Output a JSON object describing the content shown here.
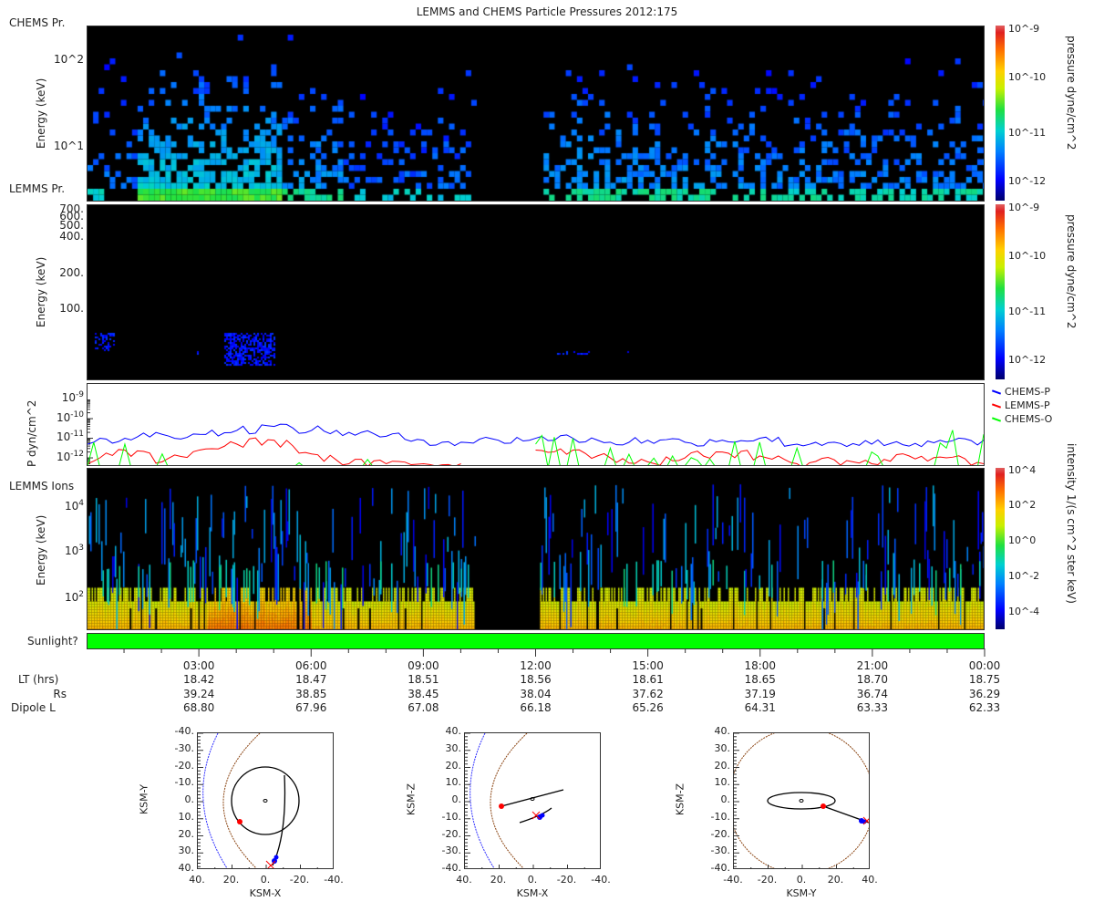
{
  "title": "LEMMS and CHEMS Particle Pressures  2012:175",
  "panel_labels": {
    "chems": "CHEMS Pr.",
    "lemms": "LEMMS Pr.",
    "ions": "LEMMS Ions",
    "sunlight": "Sunlight?"
  },
  "colorbars": {
    "pressure": {
      "label": "pressure dyne/cm^2",
      "ticks": [
        "10^-9",
        "10^-10",
        "10^-11",
        "10^-12"
      ]
    },
    "intensity": {
      "label": "intensity 1/(s cm^2 ster keV)",
      "ticks": [
        "10^4",
        "10^2",
        "10^0",
        "10^-2",
        "10^-4"
      ]
    }
  },
  "x_axis": {
    "times": [
      "03:00",
      "06:00",
      "09:00",
      "12:00",
      "15:00",
      "18:00",
      "21:00",
      "00:00"
    ],
    "rows": [
      {
        "label": "LT (hrs)",
        "values": [
          "18.42",
          "18.47",
          "18.51",
          "18.56",
          "18.61",
          "18.65",
          "18.70",
          "18.75"
        ]
      },
      {
        "label": "Rs",
        "values": [
          "39.24",
          "38.85",
          "38.45",
          "38.04",
          "37.62",
          "37.19",
          "36.74",
          "36.29"
        ]
      },
      {
        "label": "Dipole L",
        "values": [
          "68.80",
          "67.96",
          "67.08",
          "66.18",
          "65.26",
          "64.31",
          "63.33",
          "62.33"
        ]
      }
    ]
  },
  "chart_data": [
    {
      "type": "heatmap",
      "name": "CHEMS Pr.",
      "ylabel": "Energy (keV)",
      "yscale": "log",
      "ylim": [
        2.4,
        250
      ],
      "yticks": [
        "10^2",
        "10^1"
      ],
      "xlim_hours": [
        0,
        24
      ],
      "data_gap_hours": [
        10.4,
        12.1
      ],
      "colorbar": "pressure"
    },
    {
      "type": "heatmap",
      "name": "LEMMS Pr.",
      "ylabel": "Energy (keV)",
      "yscale": "log",
      "ylim": [
        25,
        780
      ],
      "yticks": [
        "700.",
        "600.",
        "500.",
        "400.",
        "200.",
        "100."
      ],
      "xlim_hours": [
        0,
        24
      ],
      "colorbar": "pressure"
    },
    {
      "type": "line",
      "ylabel": "P dyn/cm^2",
      "yscale": "log",
      "ylim": [
        4.3e-13,
        6e-09
      ],
      "yticks": [
        "10^-9",
        "10^-10",
        "10^-11",
        "10^-12"
      ],
      "x_hours": [
        0,
        1,
        2,
        3,
        4,
        5,
        6,
        7,
        8,
        9,
        10,
        11,
        12,
        13,
        14,
        15,
        16,
        17,
        18,
        19,
        20,
        21,
        22,
        23,
        24
      ],
      "series": [
        {
          "name": "CHEMS-P",
          "color": "#0000ff",
          "log10_values": [
            -11.3,
            -11.0,
            -10.8,
            -10.8,
            -10.6,
            -10.4,
            -10.6,
            -10.7,
            -10.9,
            -11.1,
            -11.2,
            -11.1,
            -11.0,
            -11.0,
            -11.2,
            -11.1,
            -11.2,
            -11.1,
            -11.0,
            -11.3,
            -11.2,
            -11.3,
            -11.4,
            -11.2,
            -11.1
          ]
        },
        {
          "name": "LEMMS-P",
          "color": "#ff0000",
          "log10_values": [
            -12.3,
            -11.6,
            -12.2,
            -11.6,
            -11.3,
            -11.1,
            -11.8,
            -12.3,
            -12.3,
            -12.3,
            -12.3,
            null,
            -11.6,
            -11.6,
            -12.0,
            -12.2,
            -12.0,
            -11.7,
            -11.9,
            -12.3,
            -12.1,
            -12.3,
            -11.9,
            -12.0,
            -12.3
          ]
        },
        {
          "name": "CHEMS-O",
          "color": "#00ff00",
          "log10_values": [
            -12.4,
            -11.3,
            -11.8,
            -12.4,
            -12.4,
            -12.4,
            -12.4,
            -12.4,
            -12.4,
            -12.4,
            null,
            null,
            -11.3,
            -11.0,
            -11.5,
            -12.4,
            -12.4,
            -12.4,
            -11.2,
            -11.5,
            -12.4,
            -11.7,
            -12.4,
            -11.5,
            -10.8
          ]
        }
      ],
      "legend": "right"
    },
    {
      "type": "heatmap",
      "name": "LEMMS Ions",
      "ylabel": "Energy (keV)",
      "yscale": "log",
      "ylim": [
        21,
        72000
      ],
      "yticks": [
        "10^4",
        "10^3",
        "10^2"
      ],
      "xlim_hours": [
        0,
        24
      ],
      "data_gap_hours": [
        10.4,
        12.1
      ],
      "colorbar": "intensity"
    }
  ],
  "orbits": [
    {
      "xlabel": "KSM-X",
      "ylabel": "KSM-Y",
      "xticks": [
        "40.",
        "20.",
        "0.",
        "-20.",
        "-40."
      ],
      "yticks": [
        "-40.",
        "-30.",
        "-20.",
        "-10.",
        "0.",
        "10.",
        "20.",
        "30.",
        "40."
      ]
    },
    {
      "xlabel": "KSM-X",
      "ylabel": "KSM-Z",
      "xticks": [
        "40.",
        "20.",
        "0.",
        "-20.",
        "-40."
      ],
      "yticks": [
        "40.",
        "30.",
        "20.",
        "10.",
        "0.",
        "-10.",
        "-20.",
        "-30.",
        "-40."
      ]
    },
    {
      "xlabel": "KSM-Y",
      "ylabel": "KSM-Z",
      "xticks": [
        "-40.",
        "-20.",
        "0.",
        "20.",
        "40."
      ],
      "yticks": [
        "40.",
        "30.",
        "20.",
        "10.",
        "0.",
        "-10.",
        "-20.",
        "-30.",
        "-40."
      ]
    }
  ]
}
